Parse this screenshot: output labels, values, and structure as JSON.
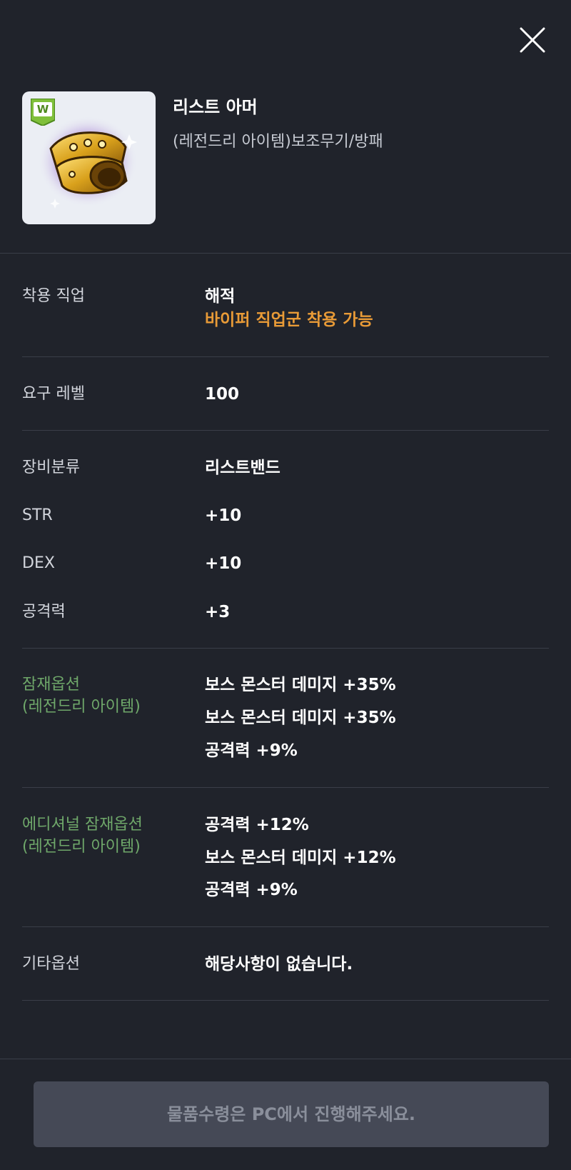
{
  "item": {
    "name": "리스트 아머",
    "type": "(레전드리 아이템)보조무기/방패",
    "badge": "W",
    "icon": "gold-wrist-armor-icon"
  },
  "details": {
    "job": {
      "label": "착용 직업",
      "value": "해적",
      "note": "바이퍼 직업군 착용 가능"
    },
    "level": {
      "label": "요구 레벨",
      "value": "100"
    },
    "stats": [
      {
        "label": "장비분류",
        "value": "리스트밴드"
      },
      {
        "label": "STR",
        "value": "+10"
      },
      {
        "label": "DEX",
        "value": "+10"
      },
      {
        "label": "공격력",
        "value": "+3"
      }
    ],
    "potential": {
      "label1": "잠재옵션",
      "label2": "(레전드리 아이템)",
      "lines": [
        "보스 몬스터 데미지 +35%",
        "보스 몬스터 데미지 +35%",
        "공격력 +9%"
      ]
    },
    "additional": {
      "label1": "에디셔널 잠재옵션",
      "label2": "(레전드리 아이템)",
      "lines": [
        "공격력 +12%",
        "보스 몬스터 데미지 +12%",
        "공격력 +9%"
      ]
    },
    "etc": {
      "label": "기타옵션",
      "value": "해당사항이 없습니다."
    }
  },
  "footer": {
    "notice": "물품수령은 PC에서 진행해주세요."
  },
  "colors": {
    "background": "#20232b",
    "accent_orange": "#e99b37",
    "potential_green": "#6fa86a",
    "disabled_button": "#454956"
  }
}
